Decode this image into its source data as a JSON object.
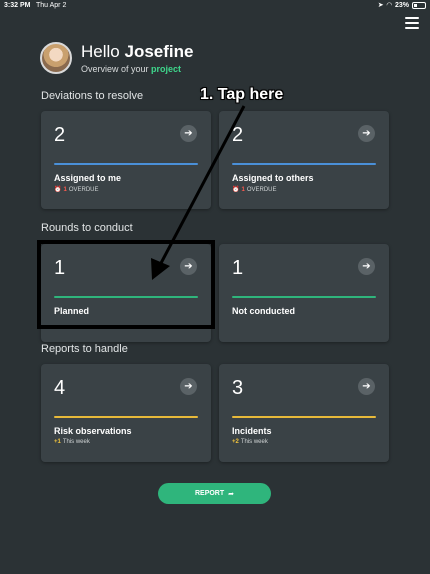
{
  "status_bar": {
    "time": "3:32 PM",
    "date": "Thu Apr 2",
    "battery": "23%"
  },
  "header": {
    "hello": "Hello",
    "name": "Josefine",
    "subtitle_prefix": "Overview of your",
    "subtitle_accent": "project"
  },
  "sections": {
    "deviations": {
      "title": "Deviations to resolve",
      "cards": [
        {
          "value": "2",
          "label": "Assigned to me",
          "badge_count": "1",
          "badge_text": "OVERDUE"
        },
        {
          "value": "2",
          "label": "Assigned to others",
          "badge_count": "1",
          "badge_text": "OVERDUE"
        }
      ]
    },
    "rounds": {
      "title": "Rounds to conduct",
      "cards": [
        {
          "value": "1",
          "label": "Planned"
        },
        {
          "value": "1",
          "label": "Not conducted"
        }
      ]
    },
    "reports": {
      "title": "Reports to handle",
      "cards": [
        {
          "value": "4",
          "label": "Risk observations",
          "badge_count": "+1",
          "badge_text": "This week"
        },
        {
          "value": "3",
          "label": "Incidents",
          "badge_count": "+2",
          "badge_text": "This week"
        }
      ]
    }
  },
  "report_button": {
    "label": "REPORT"
  },
  "annotation": {
    "text": "1. Tap here"
  },
  "colors": {
    "background": "#2b3235",
    "card": "#3a4246",
    "accent_green": "#3ed78c",
    "bar_blue": "#4a90d9",
    "bar_green": "#2fb57c",
    "bar_yellow": "#e7b93a",
    "overdue_red": "#ff5a4f"
  },
  "icons": [
    "wifi-icon",
    "battery-icon",
    "menu-icon",
    "arrow-right-icon",
    "alarm-icon",
    "share-icon"
  ]
}
